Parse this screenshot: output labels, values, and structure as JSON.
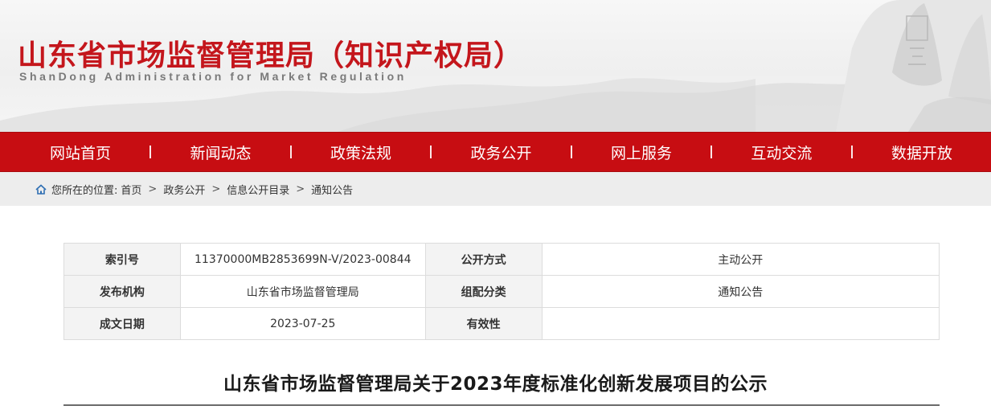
{
  "header": {
    "title": "山东省市场监督管理局（知识产权局）",
    "subtitle": "ShanDong Administration for Market Regulation"
  },
  "nav": {
    "items": [
      {
        "label": "网站首页"
      },
      {
        "label": "新闻动态"
      },
      {
        "label": "政策法规"
      },
      {
        "label": "政务公开"
      },
      {
        "label": "网上服务"
      },
      {
        "label": "互动交流"
      },
      {
        "label": "数据开放"
      }
    ]
  },
  "breadcrumb": {
    "prefix": "您所在的位置:",
    "items": [
      "首页",
      "政务公开",
      "信息公开目录",
      "通知公告"
    ],
    "separator": ">"
  },
  "meta": {
    "rows": [
      {
        "k1": "索引号",
        "v1": "11370000MB2853699N-V/2023-00844",
        "k2": "公开方式",
        "v2": "主动公开"
      },
      {
        "k1": "发布机构",
        "v1": "山东省市场监督管理局",
        "k2": "组配分类",
        "v2": "通知公告"
      },
      {
        "k1": "成文日期",
        "v1": "2023-07-25",
        "k2": "有效性",
        "v2": ""
      }
    ]
  },
  "document": {
    "title": "山东省市场监督管理局关于2023年度标准化创新发展项目的公示"
  },
  "colors": {
    "brand_red": "#c70d12",
    "title_red": "#c4161c",
    "crumb_bg": "#ededed",
    "table_key_bg": "#f3f3f3"
  }
}
